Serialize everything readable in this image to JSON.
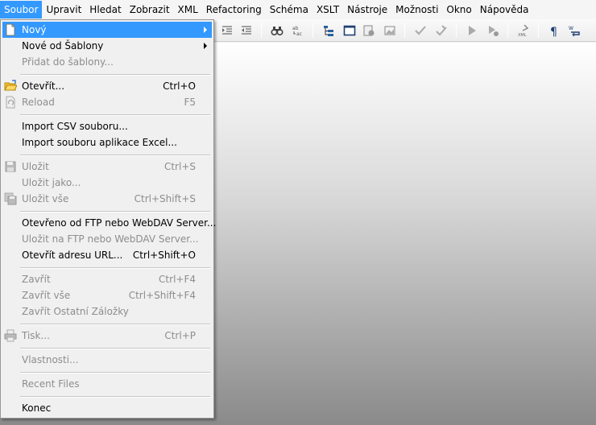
{
  "menubar": {
    "items": [
      {
        "label": "Soubor"
      },
      {
        "label": "Upravit"
      },
      {
        "label": "Hledat"
      },
      {
        "label": "Zobrazit"
      },
      {
        "label": "XML"
      },
      {
        "label": "Refactoring"
      },
      {
        "label": "Schéma"
      },
      {
        "label": "XSLT"
      },
      {
        "label": "Nástroje"
      },
      {
        "label": "Možnosti"
      },
      {
        "label": "Okno"
      },
      {
        "label": "Nápověda"
      }
    ]
  },
  "toolbar": {
    "icons": [
      "indent-icon",
      "outdent-icon",
      "find-binoculars-icon",
      "replace-icon",
      "tree-view-icon",
      "window-icon",
      "schema-icon",
      "image-icon",
      "validate-check-icon",
      "wellformed-icon",
      "run-icon",
      "debug-icon",
      "xml-tool-icon",
      "pilcrow-icon",
      "wrap-icon"
    ]
  },
  "menu": {
    "items": [
      {
        "label": "Nový",
        "shortcut": "",
        "submenu": true,
        "enabled": true
      },
      {
        "label": "Nové od Šablony",
        "shortcut": "",
        "submenu": true,
        "enabled": true
      },
      {
        "label": "Přidat do šablony...",
        "shortcut": "",
        "enabled": false
      },
      {
        "label": "Otevřít...",
        "shortcut": "Ctrl+O",
        "enabled": true
      },
      {
        "label": "Reload",
        "shortcut": "F5",
        "enabled": false
      },
      {
        "label": "Import CSV souboru...",
        "shortcut": "",
        "enabled": true
      },
      {
        "label": "Import souboru aplikace Excel...",
        "shortcut": "",
        "enabled": true
      },
      {
        "label": "Uložit",
        "shortcut": "Ctrl+S",
        "enabled": false
      },
      {
        "label": "Uložit jako...",
        "shortcut": "",
        "enabled": false
      },
      {
        "label": "Uložit vše",
        "shortcut": "Ctrl+Shift+S",
        "enabled": false
      },
      {
        "label": "Otevřeno od FTP nebo WebDAV Server...",
        "shortcut": "",
        "enabled": true
      },
      {
        "label": "Uložit na FTP nebo WebDAV Server...",
        "shortcut": "",
        "enabled": false
      },
      {
        "label": "Otevřít adresu URL...",
        "shortcut": "Ctrl+Shift+O",
        "enabled": true
      },
      {
        "label": "Zavřít",
        "shortcut": "Ctrl+F4",
        "enabled": false
      },
      {
        "label": "Zavřít vše",
        "shortcut": "Ctrl+Shift+F4",
        "enabled": false
      },
      {
        "label": "Zavřít Ostatní Záložky",
        "shortcut": "",
        "enabled": false
      },
      {
        "label": "Tisk...",
        "shortcut": "Ctrl+P",
        "enabled": false
      },
      {
        "label": "Vlastnosti...",
        "shortcut": "",
        "enabled": false
      },
      {
        "label": "Recent Files",
        "shortcut": "",
        "enabled": false
      },
      {
        "label": "Konec",
        "shortcut": "",
        "enabled": true
      }
    ]
  },
  "colors": {
    "highlight": "#3399ff",
    "disabled_text": "#8d8d8d"
  }
}
